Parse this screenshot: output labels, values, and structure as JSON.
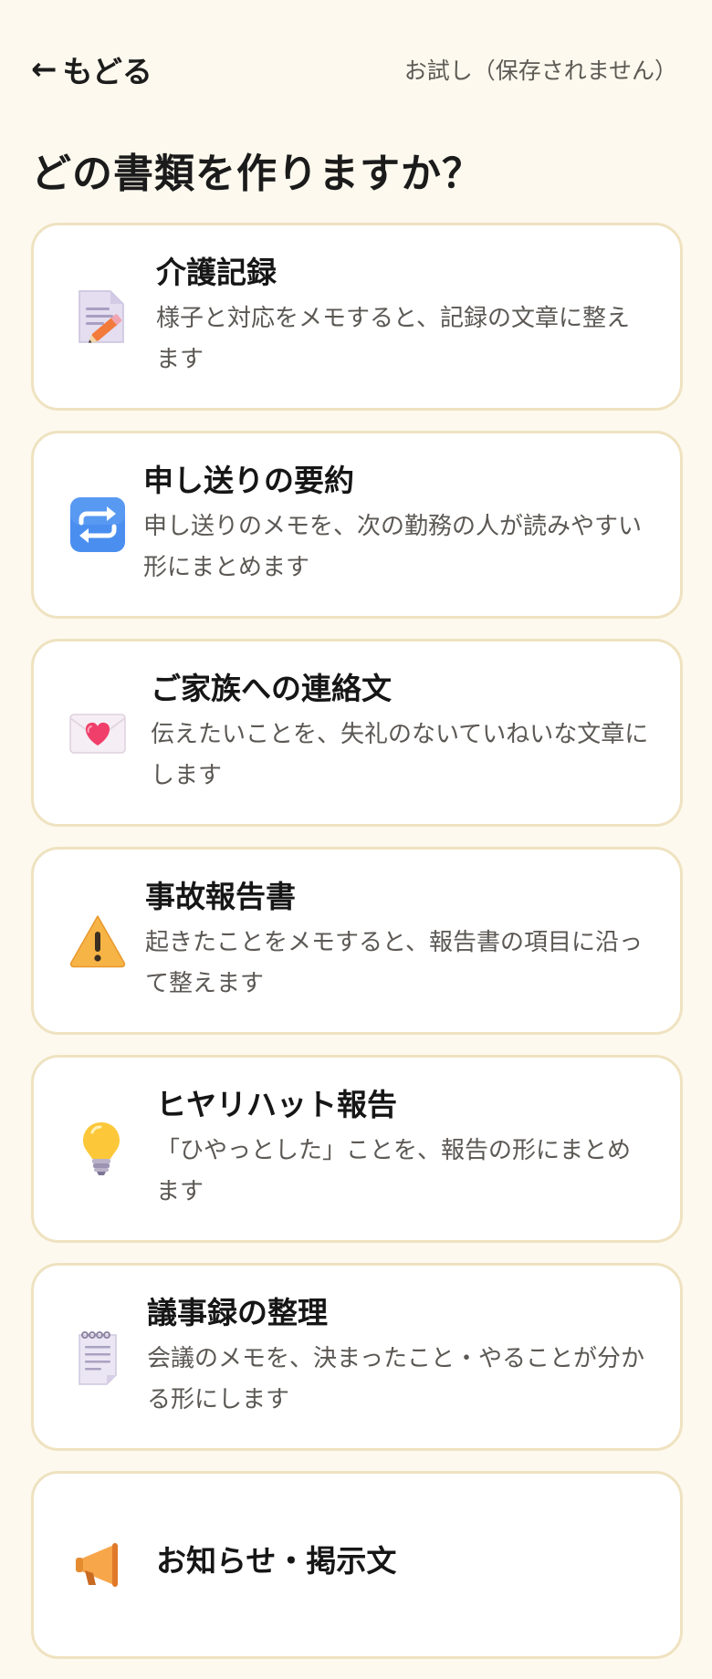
{
  "header": {
    "back_arrow": "←",
    "back_label": "もどる",
    "trial_label": "お試し（保存されません）"
  },
  "page_title": "どの書類を作りますか？",
  "documents": [
    {
      "icon": "memo-pencil-icon",
      "title": "介護記録",
      "description": "様子と対応をメモすると、記録の文章に整えます"
    },
    {
      "icon": "repeat-arrows-icon",
      "title": "申し送りの要約",
      "description": "申し送りのメモを、次の勤務の人が読みやすい形にまとめます"
    },
    {
      "icon": "love-letter-icon",
      "title": "ご家族への連絡文",
      "description": "伝えたいことを、失礼のないていねいな文章にします"
    },
    {
      "icon": "warning-icon",
      "title": "事故報告書",
      "description": "起きたことをメモすると、報告書の項目に沿って整えます"
    },
    {
      "icon": "light-bulb-icon",
      "title": "ヒヤリハット報告",
      "description": "「ひやっとした」ことを、報告の形にまとめます"
    },
    {
      "icon": "spiral-notepad-icon",
      "title": "議事録の整理",
      "description": "会議のメモを、決まったこと・やることが分かる形にします"
    },
    {
      "icon": "megaphone-icon",
      "title": "お知らせ・掲示文",
      "description": ""
    }
  ]
}
